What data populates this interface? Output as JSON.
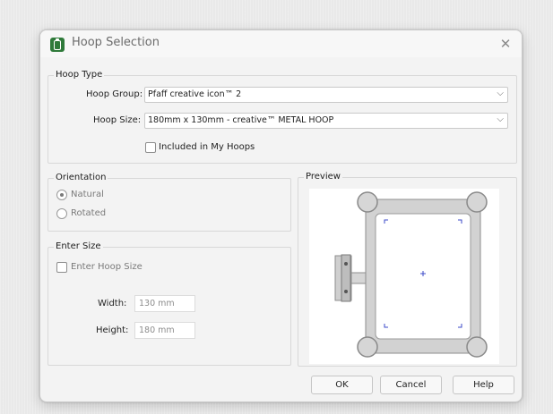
{
  "dialog": {
    "title": "Hoop Selection",
    "close_icon": "close-icon",
    "app_icon": "hoop-app-icon"
  },
  "hoop_type": {
    "legend": "Hoop Type",
    "group_label": "Hoop Group:",
    "group_value": "Pfaff creative icon™ 2",
    "size_label": "Hoop Size:",
    "size_value": "180mm x 130mm - creative™ METAL HOOP",
    "included_label": "Included in My Hoops",
    "included_checked": false
  },
  "orientation": {
    "legend": "Orientation",
    "options": [
      {
        "label": "Natural",
        "selected": true
      },
      {
        "label": "Rotated",
        "selected": false
      }
    ]
  },
  "enter_size": {
    "legend": "Enter Size",
    "checkbox_label": "Enter Hoop Size",
    "checkbox_checked": false,
    "width_label": "Width:",
    "width_value": "130 mm",
    "height_label": "Height:",
    "height_value": "180 mm"
  },
  "preview": {
    "legend": "Preview"
  },
  "buttons": {
    "ok": "OK",
    "cancel": "Cancel",
    "help": "Help"
  },
  "colors": {
    "hoop_frame": "#d2d2d2",
    "hoop_stroke": "#8e8e8e",
    "marker": "#3b48c8",
    "app_icon": "#2f7a3a"
  }
}
